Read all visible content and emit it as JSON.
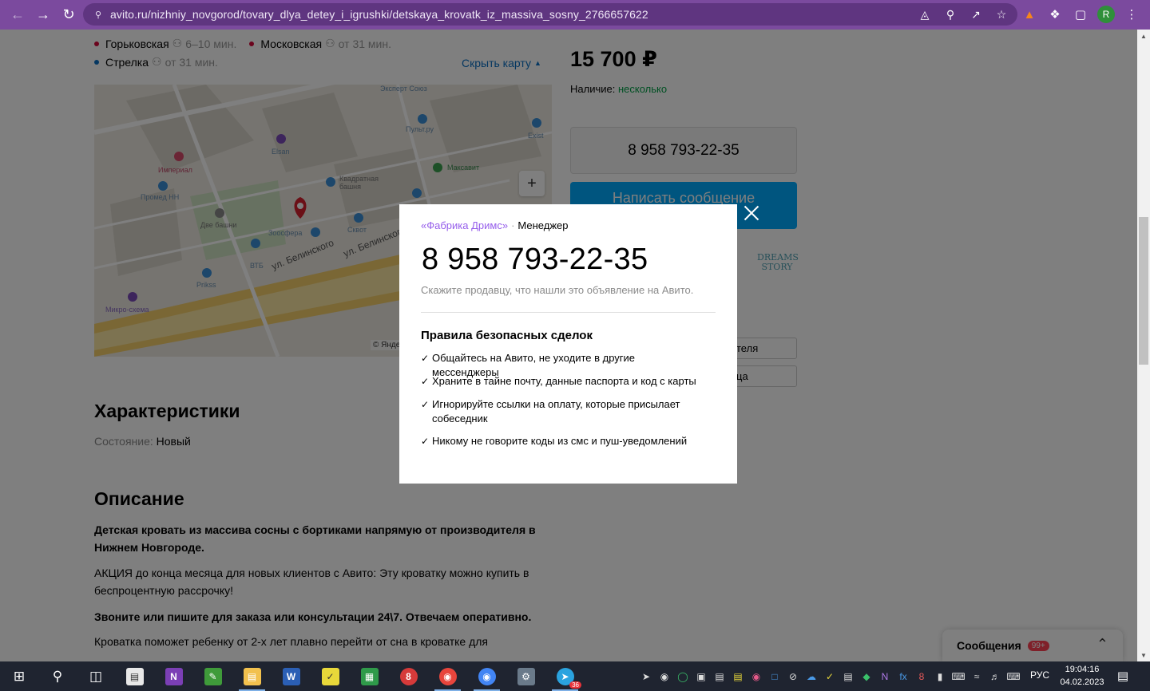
{
  "browser": {
    "url": "avito.ru/nizhniy_novgorod/tovary_dlya_detey_i_igrushki/detskaya_krovatk_iz_massiva_sosny_2766657622",
    "profile_initial": "R",
    "accent": "#7b4a9e"
  },
  "metro": [
    {
      "color": "#d6083b",
      "name": "Горьковская",
      "time": "6–10 мин."
    },
    {
      "color": "#d6083b",
      "name": "Московская",
      "time": "от 31 мин."
    },
    {
      "color": "#0a6fc2",
      "name": "Стрелка",
      "time": "от 31 мин."
    }
  ],
  "hide_map_label": "Скрыть карту",
  "map": {
    "labels": [
      "Эксперт Союз",
      "Пульт.ру",
      "Exist",
      "Elsan",
      "Империал",
      "Максавит",
      "Квадратная башня",
      "Промед НН",
      "Две башни",
      "Зоосфера",
      "Сквот",
      "ВТБ",
      "Prikss",
      "Микро-схема",
      "ул. Белинского",
      "ул. Белинского"
    ],
    "copyright": "© Янде",
    "zoom_in": "+"
  },
  "price": "15 700 ₽",
  "availability": {
    "label": "Наличие:",
    "value": "несколько"
  },
  "phone_button": "8 958 793-22-35",
  "message_button": "Написать сообщение",
  "side_links": [
    "теля",
    "ца"
  ],
  "dreams_logo": "DREAMS STORY",
  "characteristics": {
    "title": "Характеристики",
    "condition_key": "Состояние:",
    "condition_value": "Новый"
  },
  "description": {
    "title": "Описание",
    "p1": "Детская кровать из массива сосны с бортиками напрямую от производителя в Нижнем Новгороде.",
    "p2": "АКЦИЯ до конца месяца для новых клиентов с Авито: Эту кроватку можно купить в беспроцентную рассрочку!",
    "p3": "Звоните или пишите для заказа или консультации 24\\7. Отвечаем оперативно.",
    "p4": "Кроватка поможет ребенку от 2-х лет плавно перейти от сна в кроватке для"
  },
  "messages": {
    "label": "Сообщения",
    "badge": "99+"
  },
  "modal": {
    "seller_name": "«Фабрика Дримс»",
    "seller_role": "Менеджер",
    "phone": "8 958 793-22-35",
    "hint": "Скажите продавцу, что нашли это объявление на Авито.",
    "rules_title": "Правила безопасных сделок",
    "rules": [
      "Общайтесь на Авито, не уходите в другие мессенджеры",
      "Храните в тайне почту, данные паспорта и код с карты",
      "Игнорируйте ссылки на оплату, которые присылает собеседник",
      "Никому не говорите коды из смс и пуш-уведомлений"
    ]
  },
  "taskbar": {
    "telegram_badge": "36",
    "language": "РУС",
    "time": "19:04:16",
    "date": "04.02.2023"
  }
}
